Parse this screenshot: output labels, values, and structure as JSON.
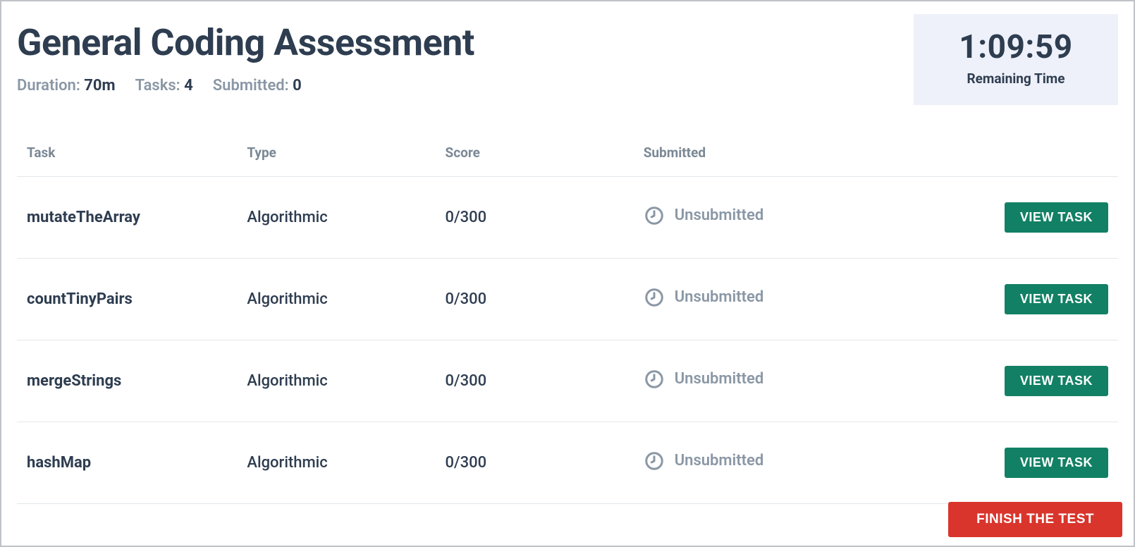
{
  "header": {
    "title": "General Coding Assessment",
    "duration_label": "Duration:",
    "duration_value": "70m",
    "tasks_label": "Tasks:",
    "tasks_value": "4",
    "submitted_label": "Submitted:",
    "submitted_value": "0"
  },
  "timer": {
    "time": "1:09:59",
    "label": "Remaining Time"
  },
  "table": {
    "columns": {
      "task": "Task",
      "type": "Type",
      "score": "Score",
      "submitted": "Submitted"
    },
    "view_button_label": "VIEW TASK",
    "rows": [
      {
        "name": "mutateTheArray",
        "type": "Algorithmic",
        "score": "0/300",
        "submitted": "Unsubmitted"
      },
      {
        "name": "countTinyPairs",
        "type": "Algorithmic",
        "score": "0/300",
        "submitted": "Unsubmitted"
      },
      {
        "name": "mergeStrings",
        "type": "Algorithmic",
        "score": "0/300",
        "submitted": "Unsubmitted"
      },
      {
        "name": "hashMap",
        "type": "Algorithmic",
        "score": "0/300",
        "submitted": "Unsubmitted"
      }
    ]
  },
  "footer": {
    "finish_label": "FINISH THE TEST"
  }
}
